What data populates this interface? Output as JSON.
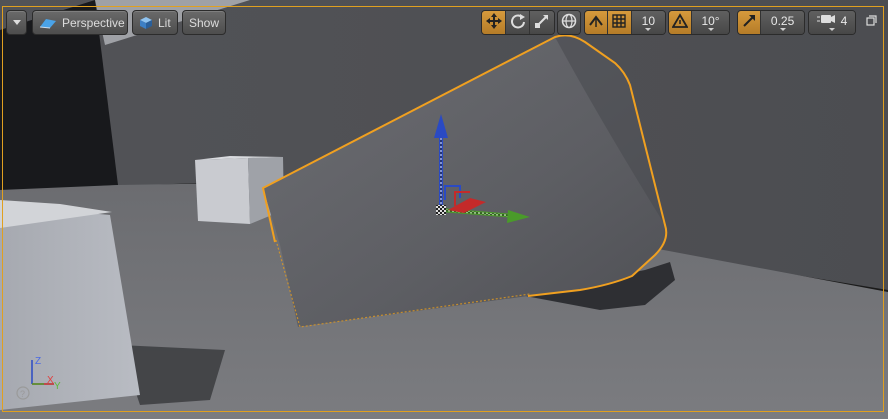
{
  "toolbar": {
    "viewport_options_menu": "viewport-options",
    "perspective_label": "Perspective",
    "lit_label": "Lit",
    "show_label": "Show",
    "grid_snap_value": "10",
    "rotation_snap_value": "10°",
    "scale_snap_value": "0.25",
    "camera_speed_value": "4"
  },
  "axis_widget": {
    "z_label": "Z",
    "x_label": "X",
    "y_label": "Y",
    "help_label": "?"
  },
  "colors": {
    "selection_outline": "#f0a020",
    "active_toggle": "#c98a30",
    "axis_x": "#c42a2a",
    "axis_y": "#4a9a2a",
    "axis_z": "#2a4ac4"
  },
  "icons": [
    "dropdown-arrow-icon",
    "perspective-icon",
    "lit-cube-icon",
    "translate-icon",
    "rotate-icon",
    "scale-icon",
    "world-globe-icon",
    "surface-snap-icon",
    "grid-icon",
    "angle-icon",
    "scale-arrow-icon",
    "camera-speed-icon",
    "maximize-icon"
  ]
}
